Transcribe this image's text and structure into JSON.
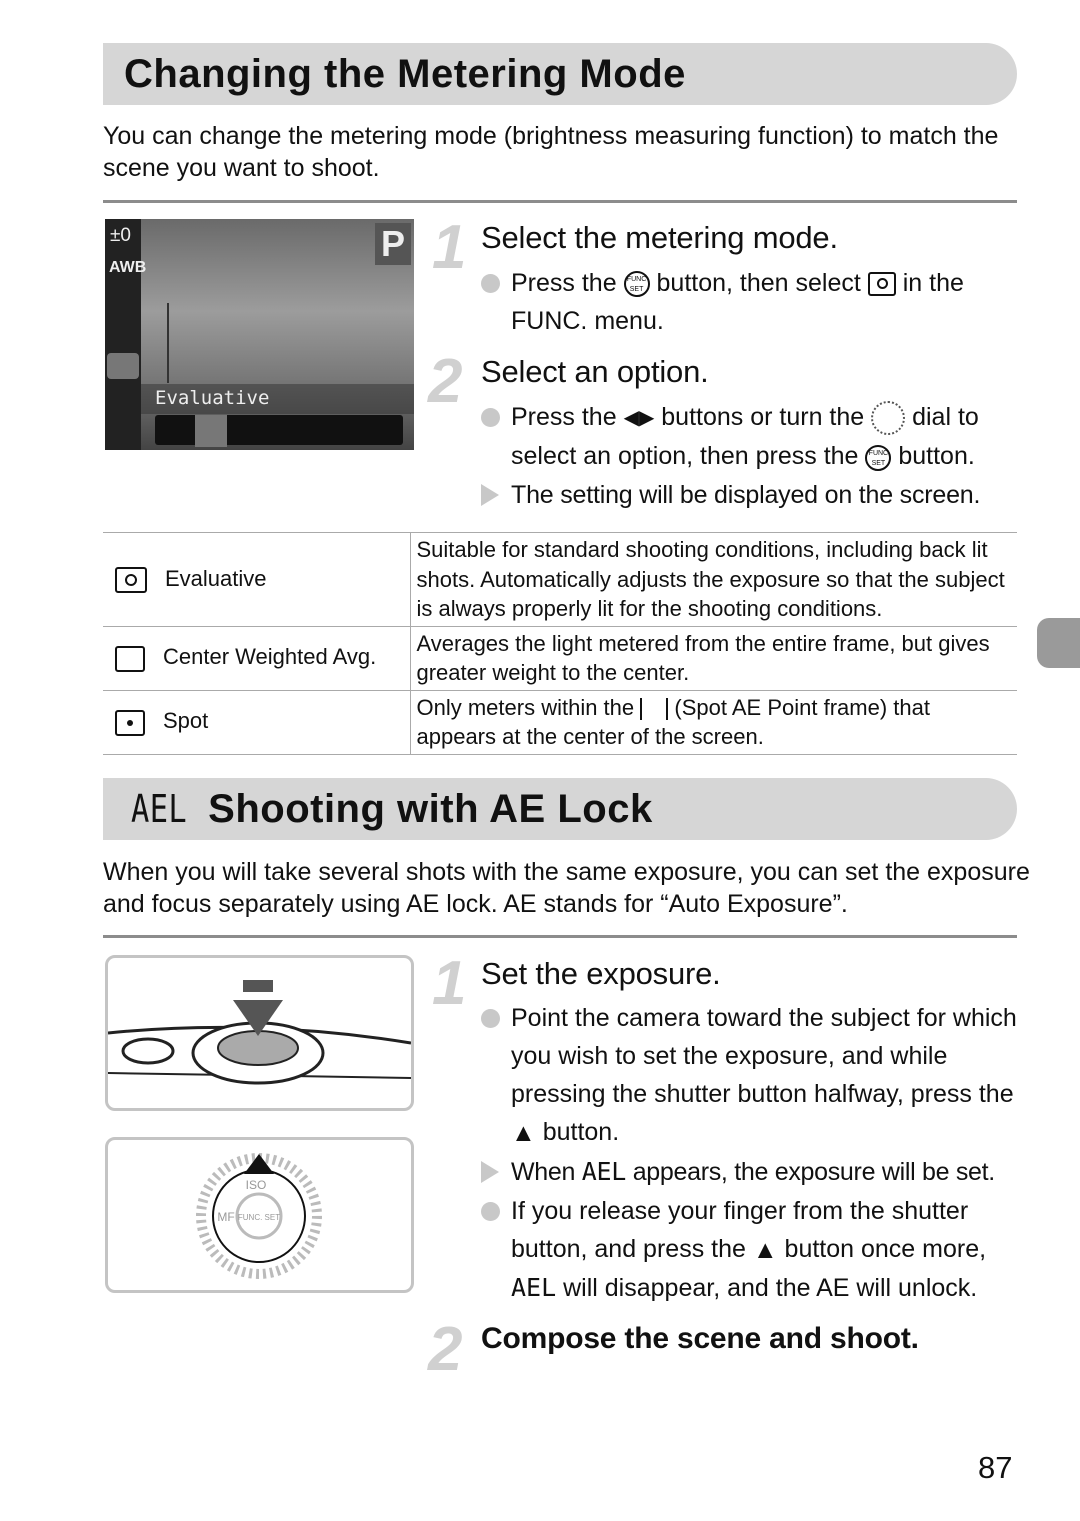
{
  "section1": {
    "title": "Changing the Metering Mode",
    "intro": "You can change the metering mode (brightness measuring function) to match the scene you want to shoot.",
    "screen": {
      "mode": "P",
      "left_icons": [
        "±0",
        "AWB"
      ],
      "label": "Evaluative"
    },
    "steps": [
      {
        "number": "1",
        "heading": "Select the metering mode.",
        "bullet_a": "Press the",
        "bullet_b": "button, then select",
        "bullet_c": "in the FUNC. menu."
      },
      {
        "number": "2",
        "heading": "Select an option.",
        "bullet_a": "Press the",
        "bullet_b": "buttons or turn the",
        "bullet_c": "dial to select an option, then press the",
        "bullet_d": "button.",
        "result": "The setting will be displayed on the screen."
      }
    ],
    "table": [
      {
        "icon": "evaluative-metering-icon",
        "name": "Evaluative",
        "desc": "Suitable for standard shooting conditions, including back lit shots. Automatically adjusts the exposure so that the subject is always properly lit for the shooting conditions."
      },
      {
        "icon": "center-weighted-icon",
        "name": "Center Weighted Avg.",
        "desc": "Averages the light metered from the entire frame, but gives greater weight to the center."
      },
      {
        "icon": "spot-metering-icon",
        "name": "Spot",
        "desc_a": "Only meters within the",
        "desc_b": "(Spot AE Point frame) that appears at the center of the screen."
      }
    ]
  },
  "section2": {
    "title_icon": "AEL",
    "title": "Shooting with AE Lock",
    "intro": "When you will take several shots with the same exposure, you can set the exposure and focus separately using AE lock. AE stands for “Auto Exposure”.",
    "steps": [
      {
        "number": "1",
        "heading": "Set the exposure.",
        "bullet1": "Point the camera toward the subject for which you wish to set the exposure, and while pressing the shutter button halfway, press the",
        "bullet1_end": "button.",
        "result_a": "When",
        "result_icon": "AEL",
        "result_b": "appears, the exposure will be set.",
        "bullet2": "If you release your finger from the shutter button, and press the",
        "bullet2_b": "button once more,",
        "bullet2_icon": "AEL",
        "bullet2_c": "will disappear, and the AE will unlock."
      },
      {
        "number": "2",
        "heading": "Compose the scene and shoot."
      }
    ],
    "dial_labels": {
      "center": "FUNC. SET",
      "iso": "ISO",
      "mf": "MF"
    }
  },
  "page_number": "87"
}
